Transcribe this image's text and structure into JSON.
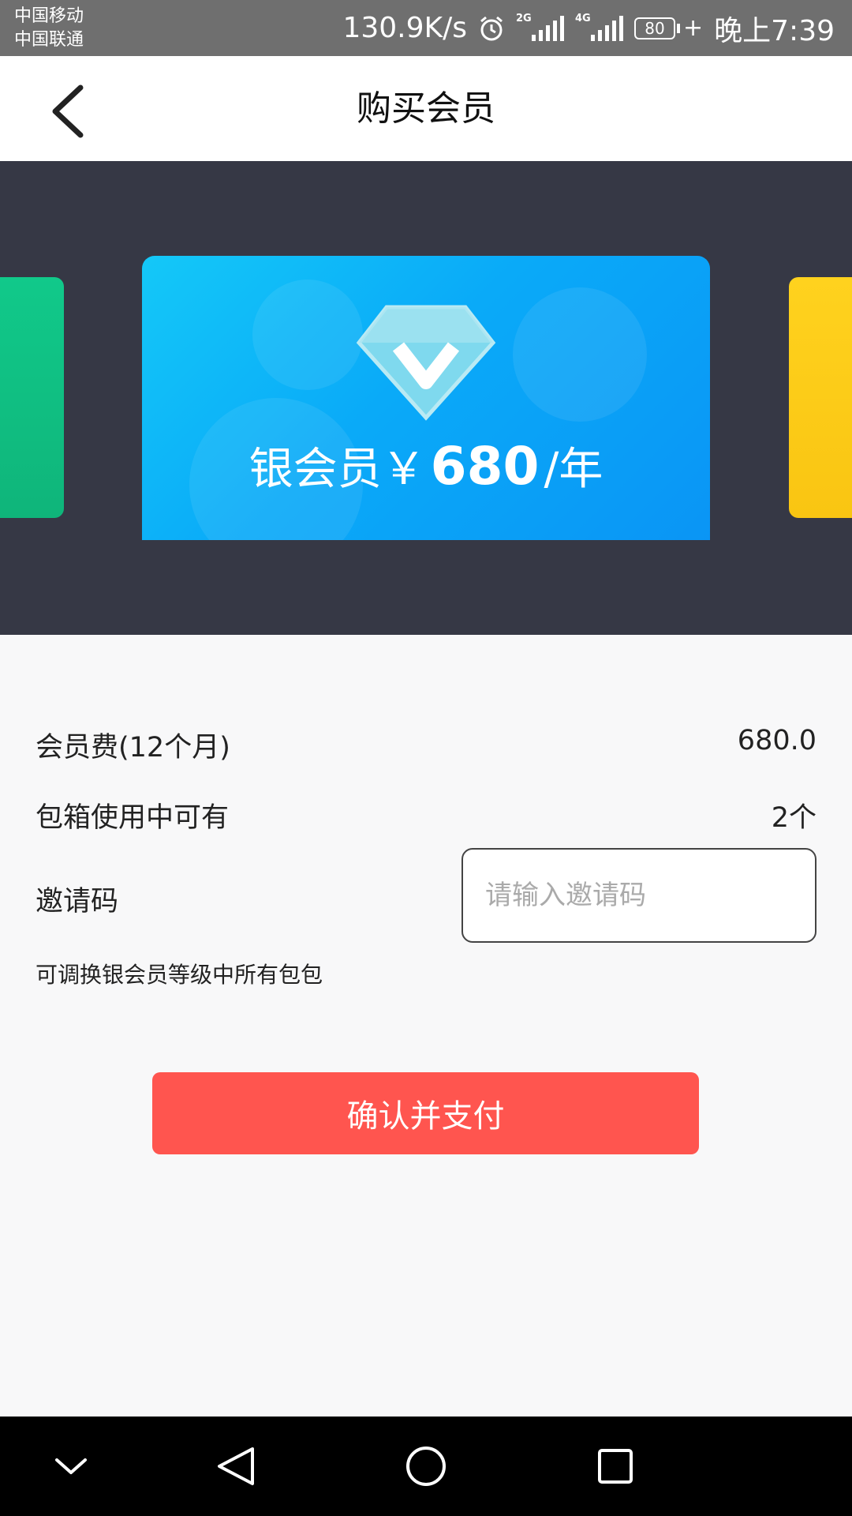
{
  "status_bar": {
    "carrier1": "中国移动",
    "carrier2": "中国联通",
    "speed": "130.9K/s",
    "net1": "2G",
    "net2": "4G",
    "battery": "80",
    "time": "晚上7:39"
  },
  "header": {
    "title": "购买会员"
  },
  "card": {
    "name": "银会员",
    "currency": "￥",
    "price": "680",
    "unit": "/年"
  },
  "details": {
    "fee_label": "会员费(12个月)",
    "fee_value": "680.0",
    "boxes_label": "包箱使用中可有",
    "boxes_value": "2个",
    "invite_label": "邀请码",
    "invite_placeholder": "请输入邀请码",
    "invite_value": "",
    "note": "可调换银会员等级中所有包包"
  },
  "actions": {
    "pay_label": "确认并支付"
  },
  "colors": {
    "accent": "#ff554f",
    "banner_bg": "#363845",
    "card_blue": "#0aaaf8",
    "card_green": "#11c98a",
    "card_yellow": "#ffd21e"
  }
}
